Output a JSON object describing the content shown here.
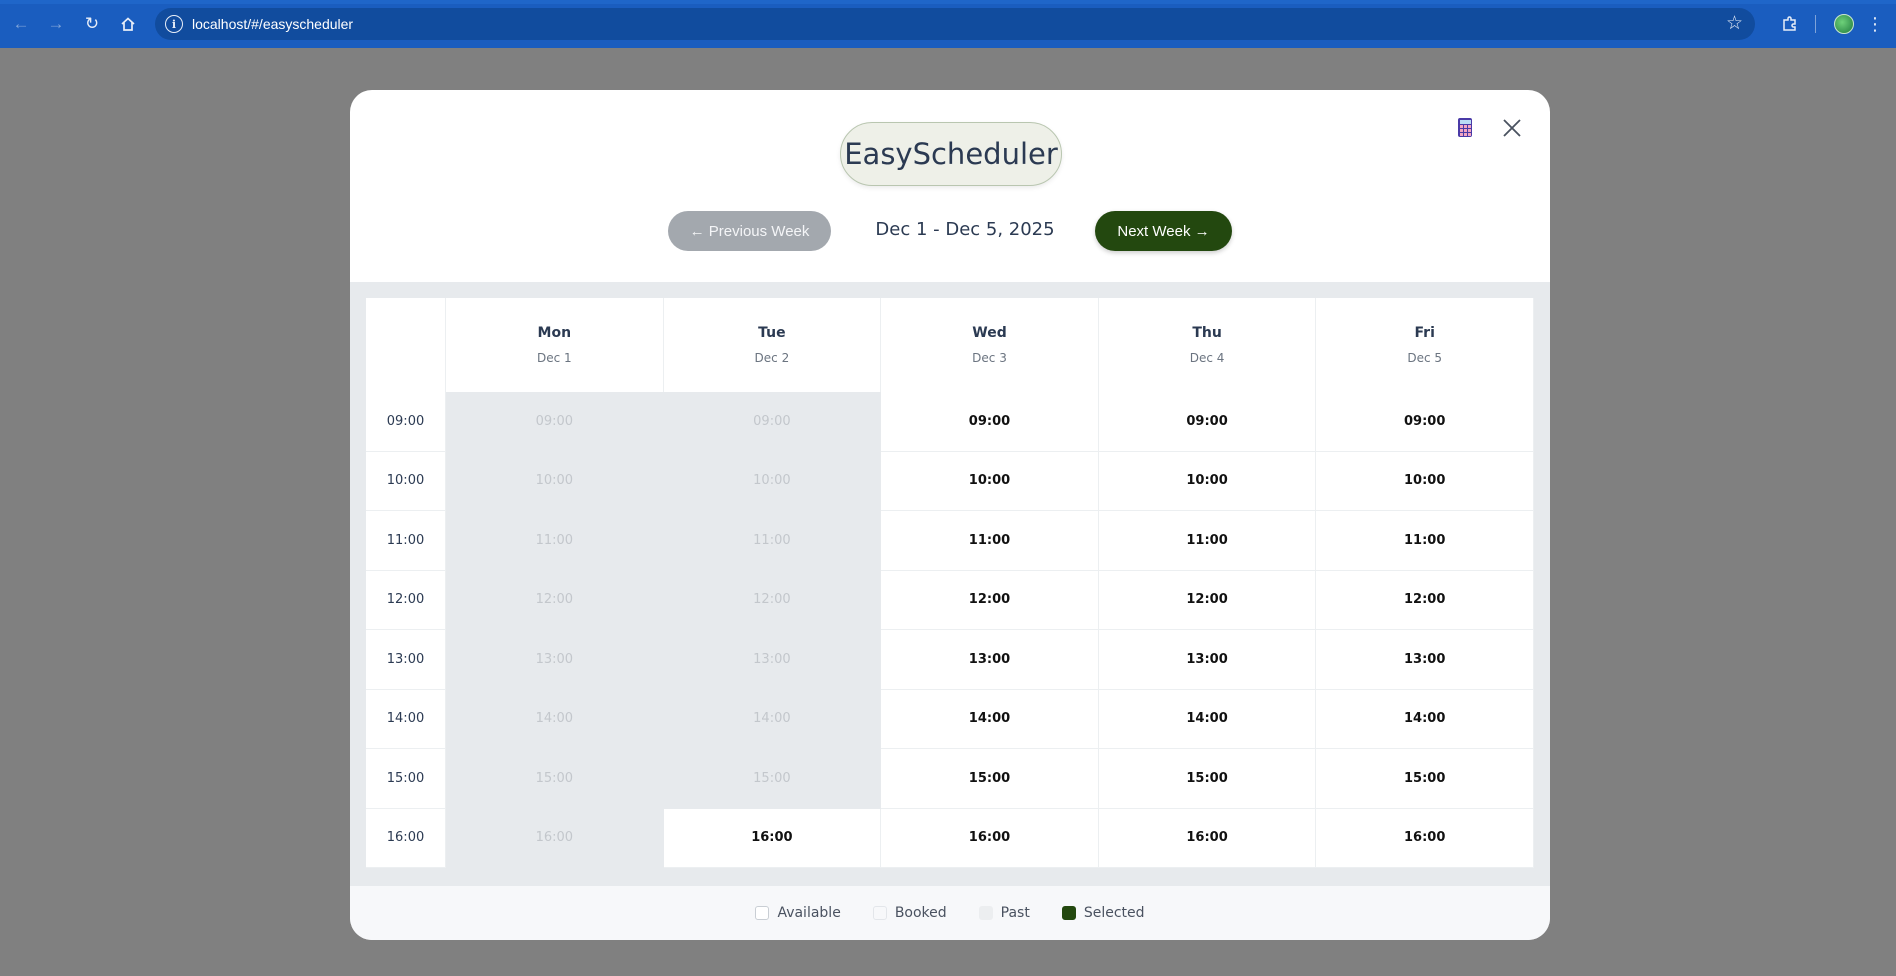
{
  "browser": {
    "url": "localhost/#/easyscheduler"
  },
  "app": {
    "title": "EasyScheduler"
  },
  "week": {
    "prev_label": "← Previous Week",
    "range_label": "Dec 1 - Dec 5, 2025",
    "next_label": "Next Week →"
  },
  "days": [
    {
      "name": "Mon",
      "date": "Dec 1"
    },
    {
      "name": "Tue",
      "date": "Dec 2"
    },
    {
      "name": "Wed",
      "date": "Dec 3"
    },
    {
      "name": "Thu",
      "date": "Dec 4"
    },
    {
      "name": "Fri",
      "date": "Dec 5"
    }
  ],
  "times": [
    "09:00",
    "10:00",
    "11:00",
    "12:00",
    "13:00",
    "14:00",
    "15:00",
    "16:00"
  ],
  "slots": [
    [
      "past",
      "past",
      "available",
      "available",
      "available"
    ],
    [
      "past",
      "past",
      "available",
      "available",
      "available"
    ],
    [
      "past",
      "past",
      "available",
      "available",
      "available"
    ],
    [
      "past",
      "past",
      "available",
      "available",
      "available"
    ],
    [
      "past",
      "past",
      "available",
      "available",
      "available"
    ],
    [
      "past",
      "past",
      "available",
      "available",
      "available"
    ],
    [
      "past",
      "past",
      "available",
      "available",
      "available"
    ],
    [
      "past",
      "available",
      "available",
      "available",
      "available"
    ]
  ],
  "legend": {
    "available": "Available",
    "booked": "Booked",
    "past": "Past",
    "selected": "Selected"
  },
  "colors": {
    "accent": "#23480f",
    "past_bg": "#e7eaed",
    "disabled_button": "#a3a8ae"
  }
}
